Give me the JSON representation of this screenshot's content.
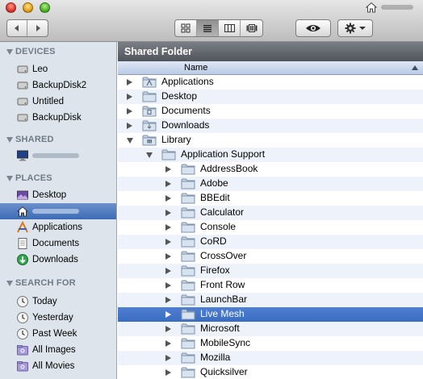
{
  "window": {
    "title": ""
  },
  "toolbar": {
    "back_label": "◀",
    "forward_label": "▶",
    "view_modes": [
      "icon",
      "list",
      "column",
      "coverflow"
    ],
    "active_view": "list"
  },
  "sidebar": {
    "devices": {
      "title": "DEVICES",
      "items": [
        "Leo",
        "BackupDisk2",
        "Untitled",
        "BackupDisk"
      ]
    },
    "shared": {
      "title": "SHARED"
    },
    "places": {
      "title": "PLACES",
      "items": [
        "Desktop",
        "",
        "Applications",
        "Documents",
        "Downloads"
      ]
    },
    "search": {
      "title": "SEARCH FOR",
      "items": [
        "Today",
        "Yesterday",
        "Past Week",
        "All Images",
        "All Movies"
      ]
    }
  },
  "main": {
    "path_title": "Shared Folder",
    "column_header": "Name",
    "rows": [
      {
        "label": "Applications"
      },
      {
        "label": "Desktop"
      },
      {
        "label": "Documents"
      },
      {
        "label": "Downloads"
      },
      {
        "label": "Library"
      },
      {
        "label": "Application Support"
      },
      {
        "label": "AddressBook"
      },
      {
        "label": "Adobe"
      },
      {
        "label": "BBEdit"
      },
      {
        "label": "Calculator"
      },
      {
        "label": "Console"
      },
      {
        "label": "CoRD"
      },
      {
        "label": "CrossOver"
      },
      {
        "label": "Firefox"
      },
      {
        "label": "Front Row"
      },
      {
        "label": "LaunchBar"
      },
      {
        "label": "Live Mesh"
      },
      {
        "label": "Microsoft"
      },
      {
        "label": "MobileSync"
      },
      {
        "label": "Mozilla"
      },
      {
        "label": "Quicksilver"
      }
    ],
    "selected_row": "Live Mesh"
  },
  "colors": {
    "selection": "#3a6cc2",
    "sidebar_bg": "#dde4eb",
    "path_bar": "#5a5f66",
    "alt_row": "#eef3fb"
  }
}
